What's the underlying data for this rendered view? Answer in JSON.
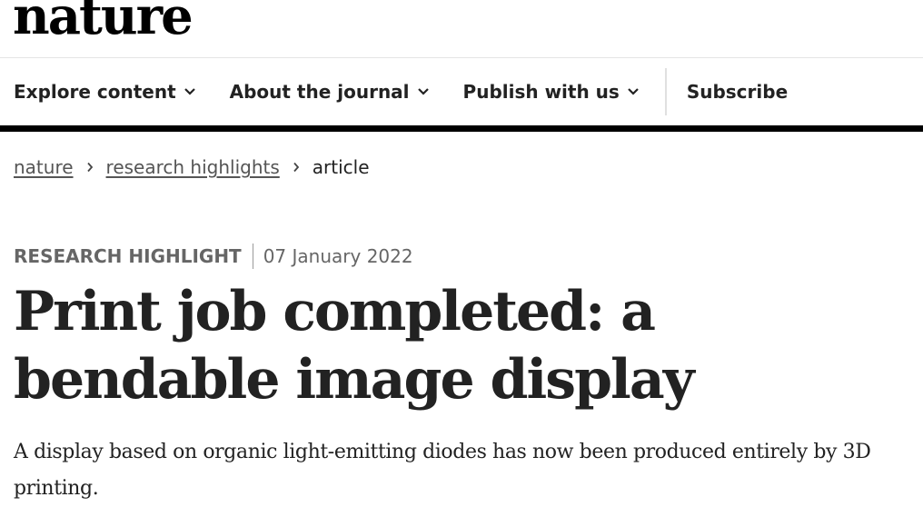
{
  "header": {
    "logo_text": "nature",
    "nav": {
      "items": [
        {
          "label": "Explore content",
          "icon": "chevron-down-icon"
        },
        {
          "label": "About the journal",
          "icon": "chevron-down-icon"
        },
        {
          "label": "Publish with us",
          "icon": "chevron-down-icon"
        }
      ],
      "subscribe_label": "Subscribe"
    }
  },
  "breadcrumb": {
    "items": [
      "nature",
      "research highlights"
    ],
    "current": "article",
    "separator_icon": "chevron-right-icon"
  },
  "article": {
    "type": "RESEARCH HIGHLIGHT",
    "date": "07 January 2022",
    "title": "Print job completed: a bendable image display",
    "standfirst": "A display based on organic light-emitting diodes has now been produced entirely by 3D printing."
  },
  "colors": {
    "text": "#222222",
    "muted": "#666666",
    "bar": "#000000",
    "rule": "#e5e5e5"
  }
}
